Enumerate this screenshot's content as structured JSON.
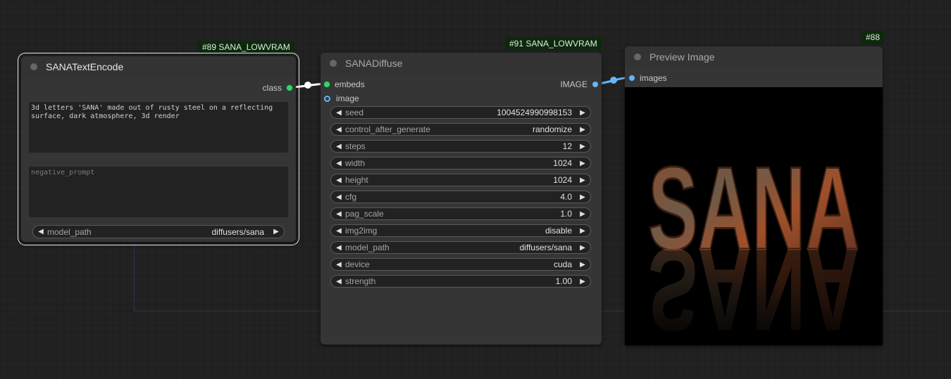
{
  "canvas": {
    "bg_color": "#222222",
    "group_line_color": "#2f3050",
    "link_colors": {
      "clip": "#ffffff",
      "image": "#64b5f6"
    }
  },
  "nodes": {
    "text_encode": {
      "badge": "#89 SANA_LOWVRAM",
      "title": "SANATextEncode",
      "output_label": "class",
      "prompt": "3d letters 'SANA' made out of rusty steel on a reflecting surface, dark atmosphere, 3d render",
      "negative_placeholder": "negative_prompt",
      "model_path": {
        "label": "model_path",
        "value": "diffusers/sana"
      }
    },
    "diffuse": {
      "badge": "#91 SANA_LOWVRAM",
      "title": "SANADiffuse",
      "inputs": [
        "embeds",
        "image"
      ],
      "output_label": "IMAGE",
      "widgets": [
        {
          "label": "seed",
          "value": "1004524990998153"
        },
        {
          "label": "control_after_generate",
          "value": "randomize"
        },
        {
          "label": "steps",
          "value": "12"
        },
        {
          "label": "width",
          "value": "1024"
        },
        {
          "label": "height",
          "value": "1024"
        },
        {
          "label": "cfg",
          "value": "4.0"
        },
        {
          "label": "pag_scale",
          "value": "1.0"
        },
        {
          "label": "img2img",
          "value": "disable"
        },
        {
          "label": "model_path",
          "value": "diffusers/sana"
        },
        {
          "label": "device",
          "value": "cuda"
        },
        {
          "label": "strength",
          "value": "1.00"
        }
      ]
    },
    "preview": {
      "badge": "#88",
      "title": "Preview Image",
      "input_label": "images",
      "image_text": "SANA"
    }
  },
  "icons": {
    "left_arrow": "◀",
    "right_arrow": "▶"
  }
}
